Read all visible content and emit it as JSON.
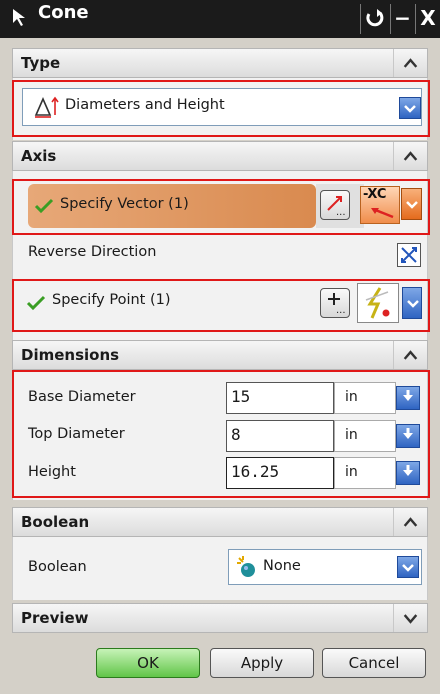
{
  "window": {
    "title": "Cone",
    "min_label": "−",
    "close_label": "X"
  },
  "type_section": {
    "title": "Type",
    "selected": "Diameters and Height"
  },
  "axis_section": {
    "title": "Axis",
    "specify_vector": "Specify Vector (1)",
    "vector_option": "-XC",
    "reverse_direction": "Reverse Direction",
    "specify_point": "Specify Point (1)"
  },
  "dimensions_section": {
    "title": "Dimensions",
    "base_diameter": {
      "label": "Base Diameter",
      "value": "15",
      "unit": "in"
    },
    "top_diameter": {
      "label": "Top Diameter",
      "value": "8",
      "unit": "in"
    },
    "height": {
      "label": "Height",
      "value": "16.25",
      "unit": "in"
    }
  },
  "boolean_section": {
    "title": "Boolean",
    "label": "Boolean",
    "selected": "None"
  },
  "preview_section": {
    "title": "Preview"
  },
  "buttons": {
    "ok": "OK",
    "apply": "Apply",
    "cancel": "Cancel"
  }
}
